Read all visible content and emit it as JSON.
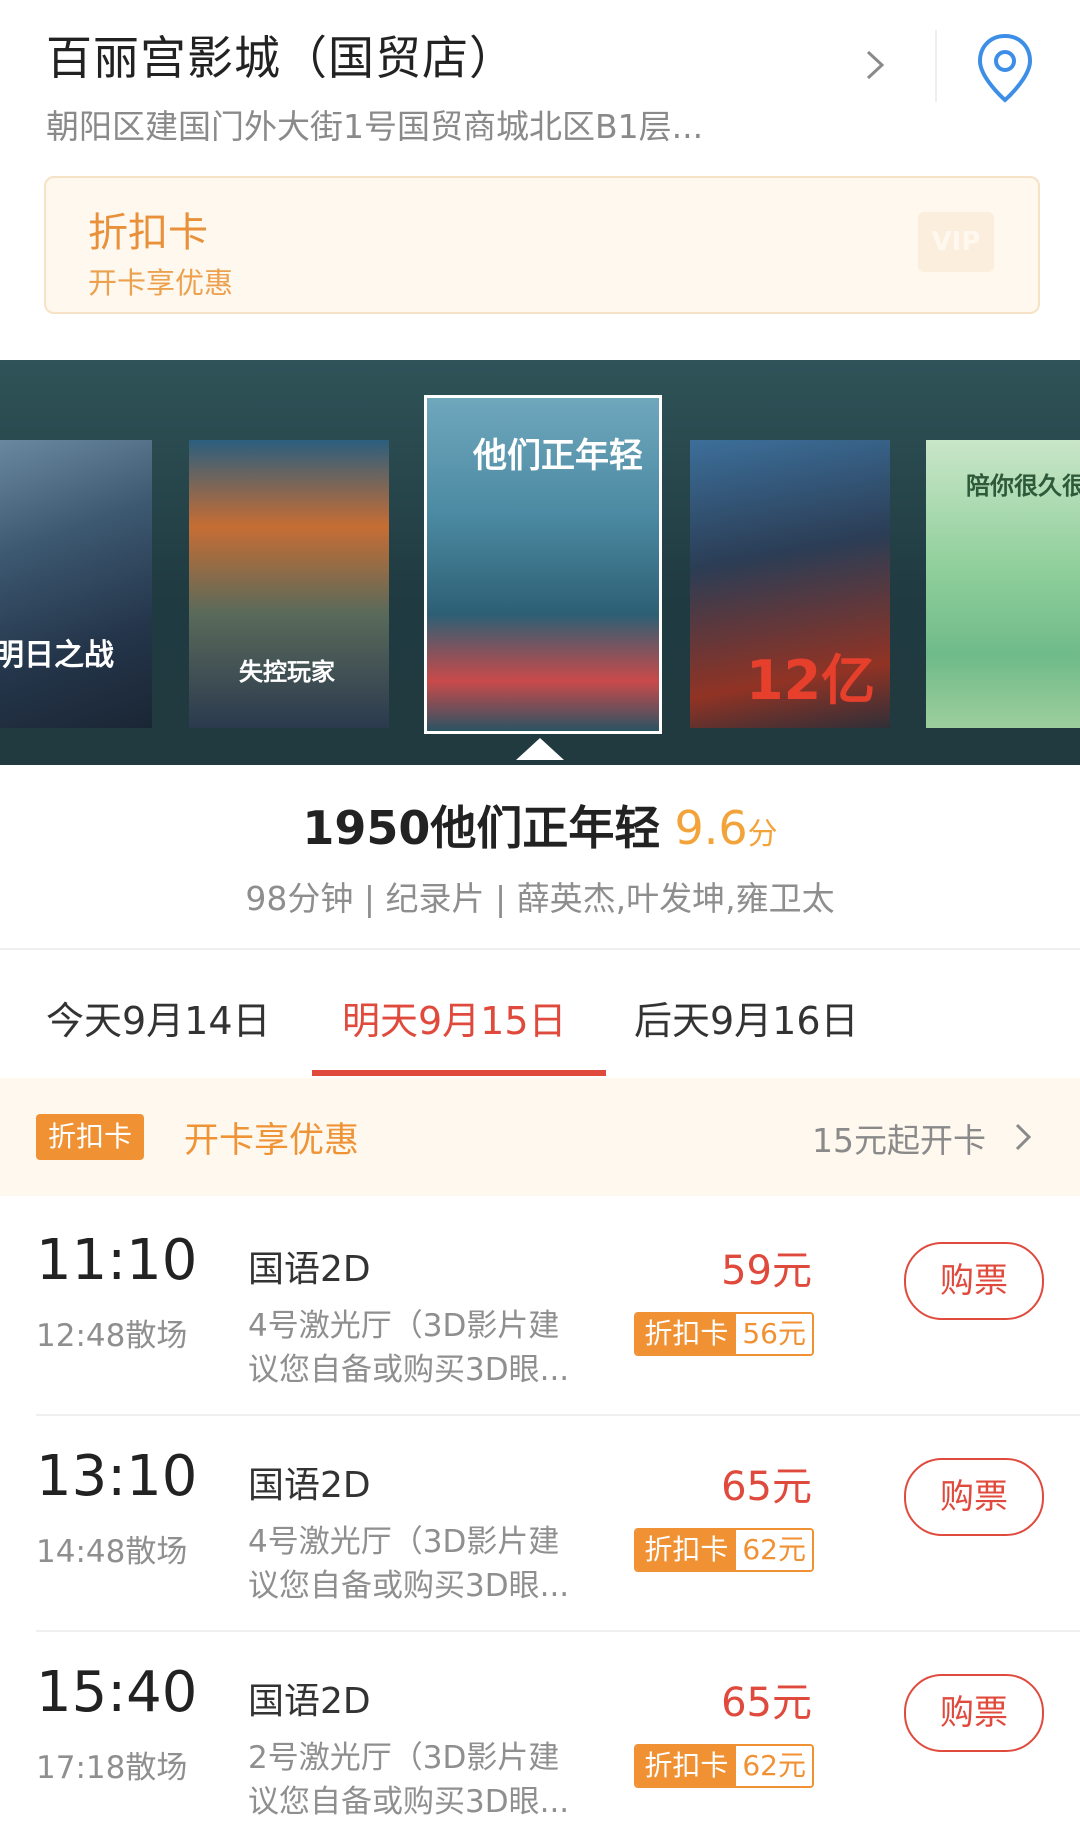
{
  "cinema": {
    "name": "百丽宫影城（国贸店）",
    "address": "朝阳区建国门外大街1号国贸商城北区B1层..."
  },
  "discount_card": {
    "title": "折扣卡",
    "subtitle": "开卡享优惠",
    "badge": "VIP"
  },
  "carousel": {
    "posters": [
      {
        "title": "明日之战"
      },
      {
        "title": "失控玩家"
      },
      {
        "title": "他们正年轻"
      },
      {
        "title": "12亿"
      },
      {
        "title": "陪你很久很久"
      }
    ],
    "selected_index": 2
  },
  "movie": {
    "title": "1950他们正年轻",
    "score": "9.6",
    "score_unit": "分",
    "meta": "98分钟 | 纪录片 | 薛英杰,叶发坤,雍卫太"
  },
  "date_tabs": [
    {
      "label": "今天9月14日",
      "active": false
    },
    {
      "label": "明天9月15日",
      "active": true
    },
    {
      "label": "后天9月16日",
      "active": false
    }
  ],
  "promo": {
    "badge": "折扣卡",
    "text": "开卡享优惠",
    "right": "15元起开卡"
  },
  "showtimes": [
    {
      "start": "11:10",
      "end": "12:48散场",
      "lang": "国语2D",
      "hall": "4号激光厅（3D影片建议您自备或购买3D眼...",
      "price": "59元",
      "disc_label": "折扣卡",
      "disc_price": "56元",
      "buy": "购票"
    },
    {
      "start": "13:10",
      "end": "14:48散场",
      "lang": "国语2D",
      "hall": "4号激光厅（3D影片建议您自备或购买3D眼...",
      "price": "65元",
      "disc_label": "折扣卡",
      "disc_price": "62元",
      "buy": "购票"
    },
    {
      "start": "15:40",
      "end": "17:18散场",
      "lang": "国语2D",
      "hall": "2号激光厅（3D影片建议您自备或购买3D眼...",
      "price": "65元",
      "disc_label": "折扣卡",
      "disc_price": "62元",
      "buy": "购票"
    }
  ],
  "colors": {
    "accent_red": "#e04a3d",
    "accent_orange": "#f09133",
    "promo_bg": "#fff8ef"
  }
}
